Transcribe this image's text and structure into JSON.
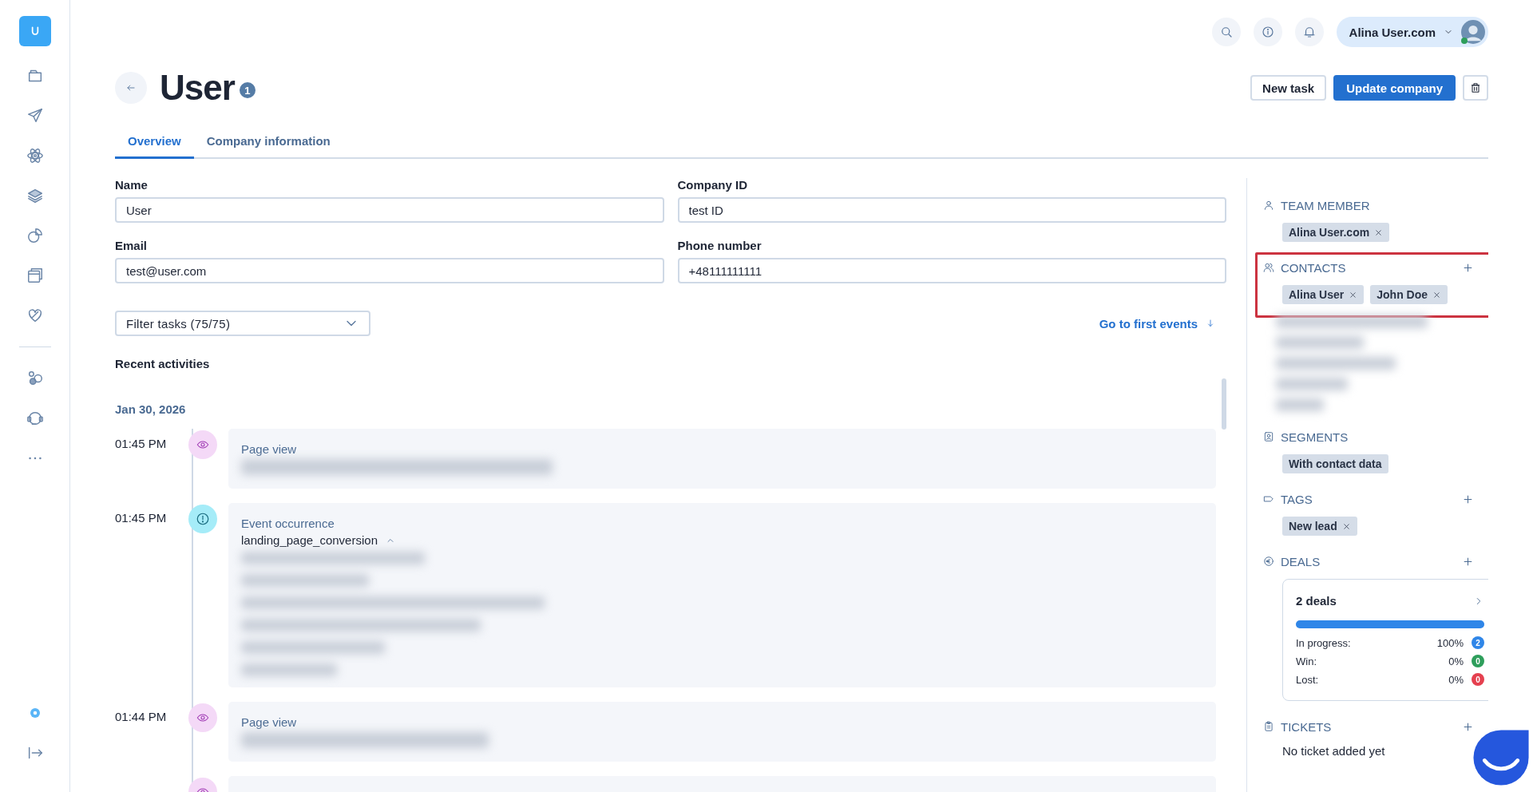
{
  "header": {
    "user_name": "Alina User.com",
    "online": true
  },
  "page": {
    "title": "User",
    "badge": "1",
    "actions": [
      {
        "kind": "secondary",
        "label": "New task"
      },
      {
        "kind": "primary",
        "label": "Update company"
      },
      {
        "kind": "delete"
      }
    ]
  },
  "tabs": [
    {
      "label": "Overview",
      "selected": true
    },
    {
      "label": "Company information",
      "selected": false
    }
  ],
  "fields": [
    {
      "label": "Name",
      "value": "User"
    },
    {
      "label": "Company ID",
      "value": "test ID"
    },
    {
      "label": "Email",
      "value": "test@user.com"
    },
    {
      "label": "Phone number",
      "value": "+48111111111"
    }
  ],
  "filter": {
    "value": "Filter tasks (75/75)"
  },
  "go_to_first": "Go to first events",
  "activities": {
    "title": "Recent activities",
    "date": "Jan 30, 2026",
    "items": [
      {
        "kind": "page_view",
        "time": "01:45 PM",
        "title": "Page view"
      },
      {
        "kind": "event",
        "time": "01:45 PM",
        "title": "Event occurrence",
        "name": "landing_page_conversion",
        "expanded": true
      },
      {
        "kind": "page_view",
        "time": "01:44 PM",
        "title": "Page view"
      },
      {
        "kind": "page_view"
      }
    ]
  },
  "side": {
    "sections": [
      {
        "kind": "team",
        "title": "TEAM MEMBER",
        "can_add": false,
        "highlighted": false,
        "chips": [
          {
            "label": "Alina User.com",
            "removable": true
          }
        ]
      },
      {
        "kind": "contacts",
        "title": "CONTACTS",
        "can_add": true,
        "highlighted": true,
        "chips": [
          {
            "label": "Alina User",
            "removable": true
          },
          {
            "label": "John Doe",
            "removable": true
          }
        ]
      },
      {
        "kind": "segments",
        "title": "SEGMENTS",
        "can_add": false,
        "highlighted": false,
        "chips": [
          {
            "label": "With contact data",
            "removable": false
          }
        ]
      },
      {
        "kind": "tags",
        "title": "TAGS",
        "can_add": true,
        "highlighted": false,
        "chips": [
          {
            "label": "New lead",
            "removable": true
          }
        ]
      },
      {
        "kind": "deals",
        "title": "DEALS",
        "can_add": true,
        "highlighted": false,
        "deals": {
          "title": "2 deals",
          "level": 1,
          "rows": [
            {
              "label": "In progress:",
              "percent": "100%",
              "count": "2",
              "color": "#2f86e8"
            },
            {
              "label": "Win:",
              "percent": "0%",
              "count": "0",
              "color": "#2e9e5b"
            },
            {
              "label": "Lost:",
              "percent": "0%",
              "count": "0",
              "color": "#e5404f"
            }
          ]
        }
      },
      {
        "kind": "tickets",
        "title": "TICKETS",
        "can_add": true,
        "highlighted": false,
        "empty_text": "No ticket added yet"
      }
    ]
  }
}
